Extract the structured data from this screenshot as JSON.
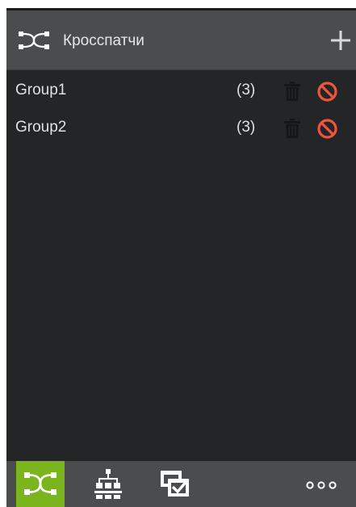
{
  "header": {
    "title": "Кросспатчи",
    "header_icon": "crosspatch-icon",
    "add_icon": "plus-icon"
  },
  "groups": [
    {
      "name": "Group1",
      "count": "(3)",
      "delete_icon": "trash-icon",
      "disable_icon": "prohibited-icon"
    },
    {
      "name": "Group2",
      "count": "(3)",
      "delete_icon": "trash-icon",
      "disable_icon": "prohibited-icon"
    }
  ],
  "footer": {
    "tabs": [
      {
        "icon": "crosspatch-icon",
        "active": true
      },
      {
        "icon": "network-tree-icon",
        "active": false
      },
      {
        "icon": "checked-windows-icon",
        "active": false
      },
      {
        "icon": "more-dots-icon",
        "active": false
      }
    ]
  },
  "colors": {
    "panel_bg": "#242527",
    "header_bg": "#4b4c4e",
    "active_tab": "#7ab51d",
    "prohibited": "#e8573f"
  }
}
